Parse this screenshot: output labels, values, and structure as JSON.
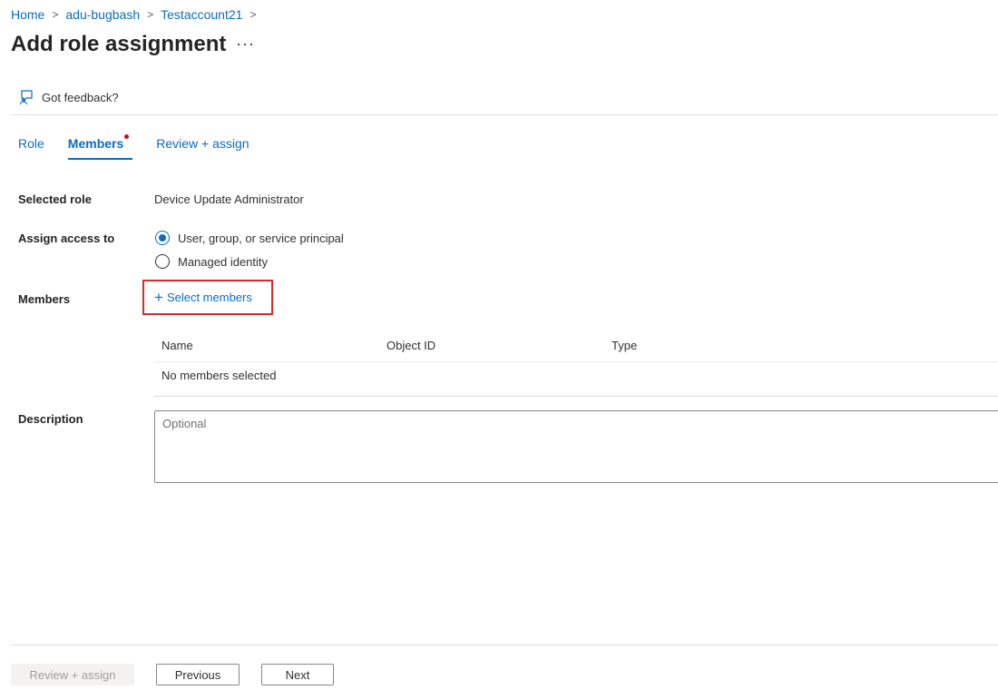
{
  "breadcrumb": {
    "items": [
      "Home",
      "adu-bugbash",
      "Testaccount21"
    ],
    "separator": ">"
  },
  "page": {
    "title": "Add role assignment",
    "more_label": "···"
  },
  "commandbar": {
    "feedback_label": "Got feedback?"
  },
  "tabs": [
    {
      "label": "Role",
      "active": false
    },
    {
      "label": "Members",
      "active": true,
      "has_indicator": true
    },
    {
      "label": "Review + assign",
      "active": false
    }
  ],
  "form": {
    "selected_role_label": "Selected role",
    "selected_role_value": "Device Update Administrator",
    "assign_access_label": "Assign access to",
    "assign_options": [
      {
        "label": "User, group, or service principal",
        "checked": true
      },
      {
        "label": "Managed identity",
        "checked": false
      }
    ],
    "members_label": "Members",
    "select_members_label": "Select members",
    "description_label": "Description",
    "description_placeholder": "Optional"
  },
  "members_table": {
    "columns": [
      "Name",
      "Object ID",
      "Type"
    ],
    "empty_text": "No members selected"
  },
  "footer": {
    "review_assign_label": "Review + assign",
    "previous_label": "Previous",
    "next_label": "Next"
  },
  "colors": {
    "accent": "#0f6cbd",
    "highlight_box": "#d92b2b",
    "indicator": "#c50f1f"
  }
}
